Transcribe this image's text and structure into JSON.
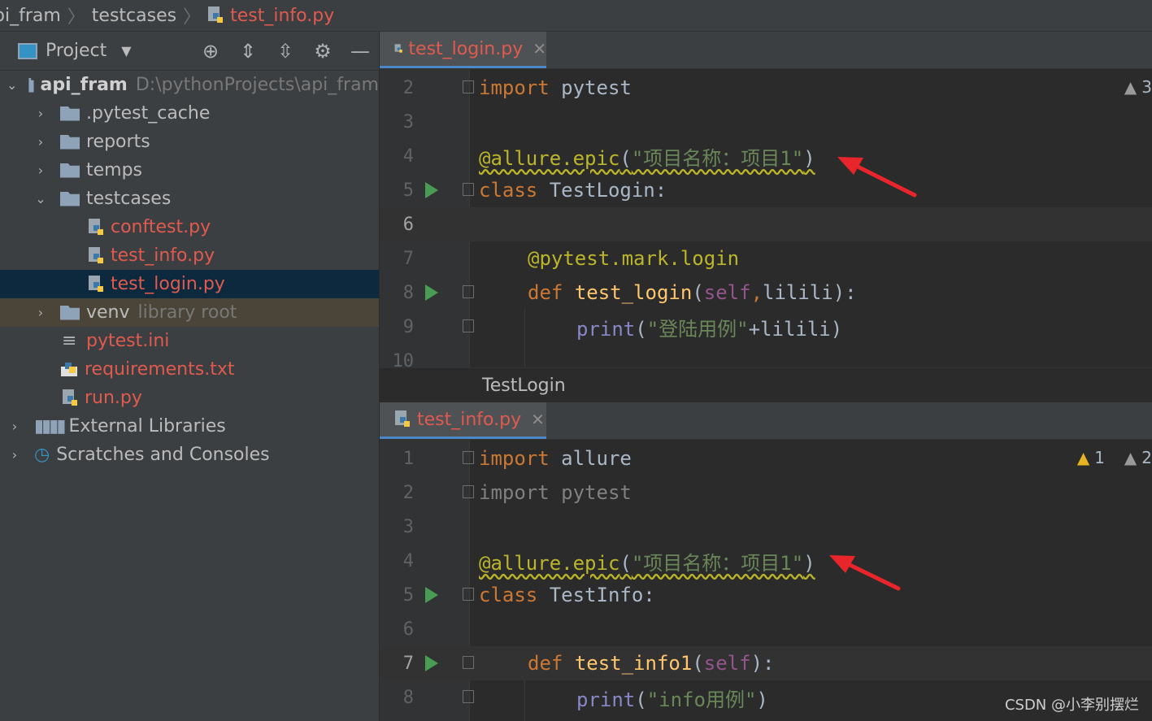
{
  "breadcrumb": {
    "project": "pi_fram",
    "folder": "testcases",
    "file": "test_info.py"
  },
  "project_panel": {
    "title": "Project",
    "tree": [
      {
        "label": "api_fram",
        "hint": "D:\\pythonProjects\\api_fram"
      },
      {
        "label": ".pytest_cache"
      },
      {
        "label": "reports"
      },
      {
        "label": "temps"
      },
      {
        "label": "testcases"
      },
      {
        "label": "conftest.py"
      },
      {
        "label": "test_info.py"
      },
      {
        "label": "test_login.py"
      },
      {
        "label": "venv",
        "hint": "library root"
      },
      {
        "label": "pytest.ini"
      },
      {
        "label": "requirements.txt"
      },
      {
        "label": "run.py"
      },
      {
        "label": "External Libraries"
      },
      {
        "label": "Scratches and Consoles"
      }
    ]
  },
  "editor_top": {
    "tab": "test_login.py",
    "warning_count": "3",
    "structure_breadcrumb": "TestLogin",
    "lines": [
      {
        "num": "2",
        "code": "import pytest"
      },
      {
        "num": "3",
        "code": ""
      },
      {
        "num": "4",
        "code": "@allure.epic(\"项目名称：项目1\")"
      },
      {
        "num": "5",
        "code": "class TestLogin:"
      },
      {
        "num": "6",
        "code": ""
      },
      {
        "num": "7",
        "code": "@pytest.mark.login"
      },
      {
        "num": "8",
        "code": "def test_login(self,lilili):"
      },
      {
        "num": "9",
        "code": "print(\"登陆用例\"+lilili)"
      },
      {
        "num": "10",
        "code": ""
      }
    ]
  },
  "editor_bottom": {
    "tab": "test_info.py",
    "warning_count_1": "1",
    "warning_count_2": "2",
    "lines": [
      {
        "num": "1",
        "code": "import allure"
      },
      {
        "num": "2",
        "code": "import pytest"
      },
      {
        "num": "3",
        "code": ""
      },
      {
        "num": "4",
        "code": "@allure.epic(\"项目名称：项目1\")"
      },
      {
        "num": "5",
        "code": "class TestInfo:"
      },
      {
        "num": "6",
        "code": ""
      },
      {
        "num": "7",
        "code": "def test_info1(self):"
      },
      {
        "num": "8",
        "code": "print(\"info用例\")"
      }
    ]
  },
  "watermark": "CSDN @小李别摆烂",
  "colors": {
    "annotation_arrow": "#e8252a",
    "keyword": "#cc7832",
    "string": "#6a8759"
  }
}
